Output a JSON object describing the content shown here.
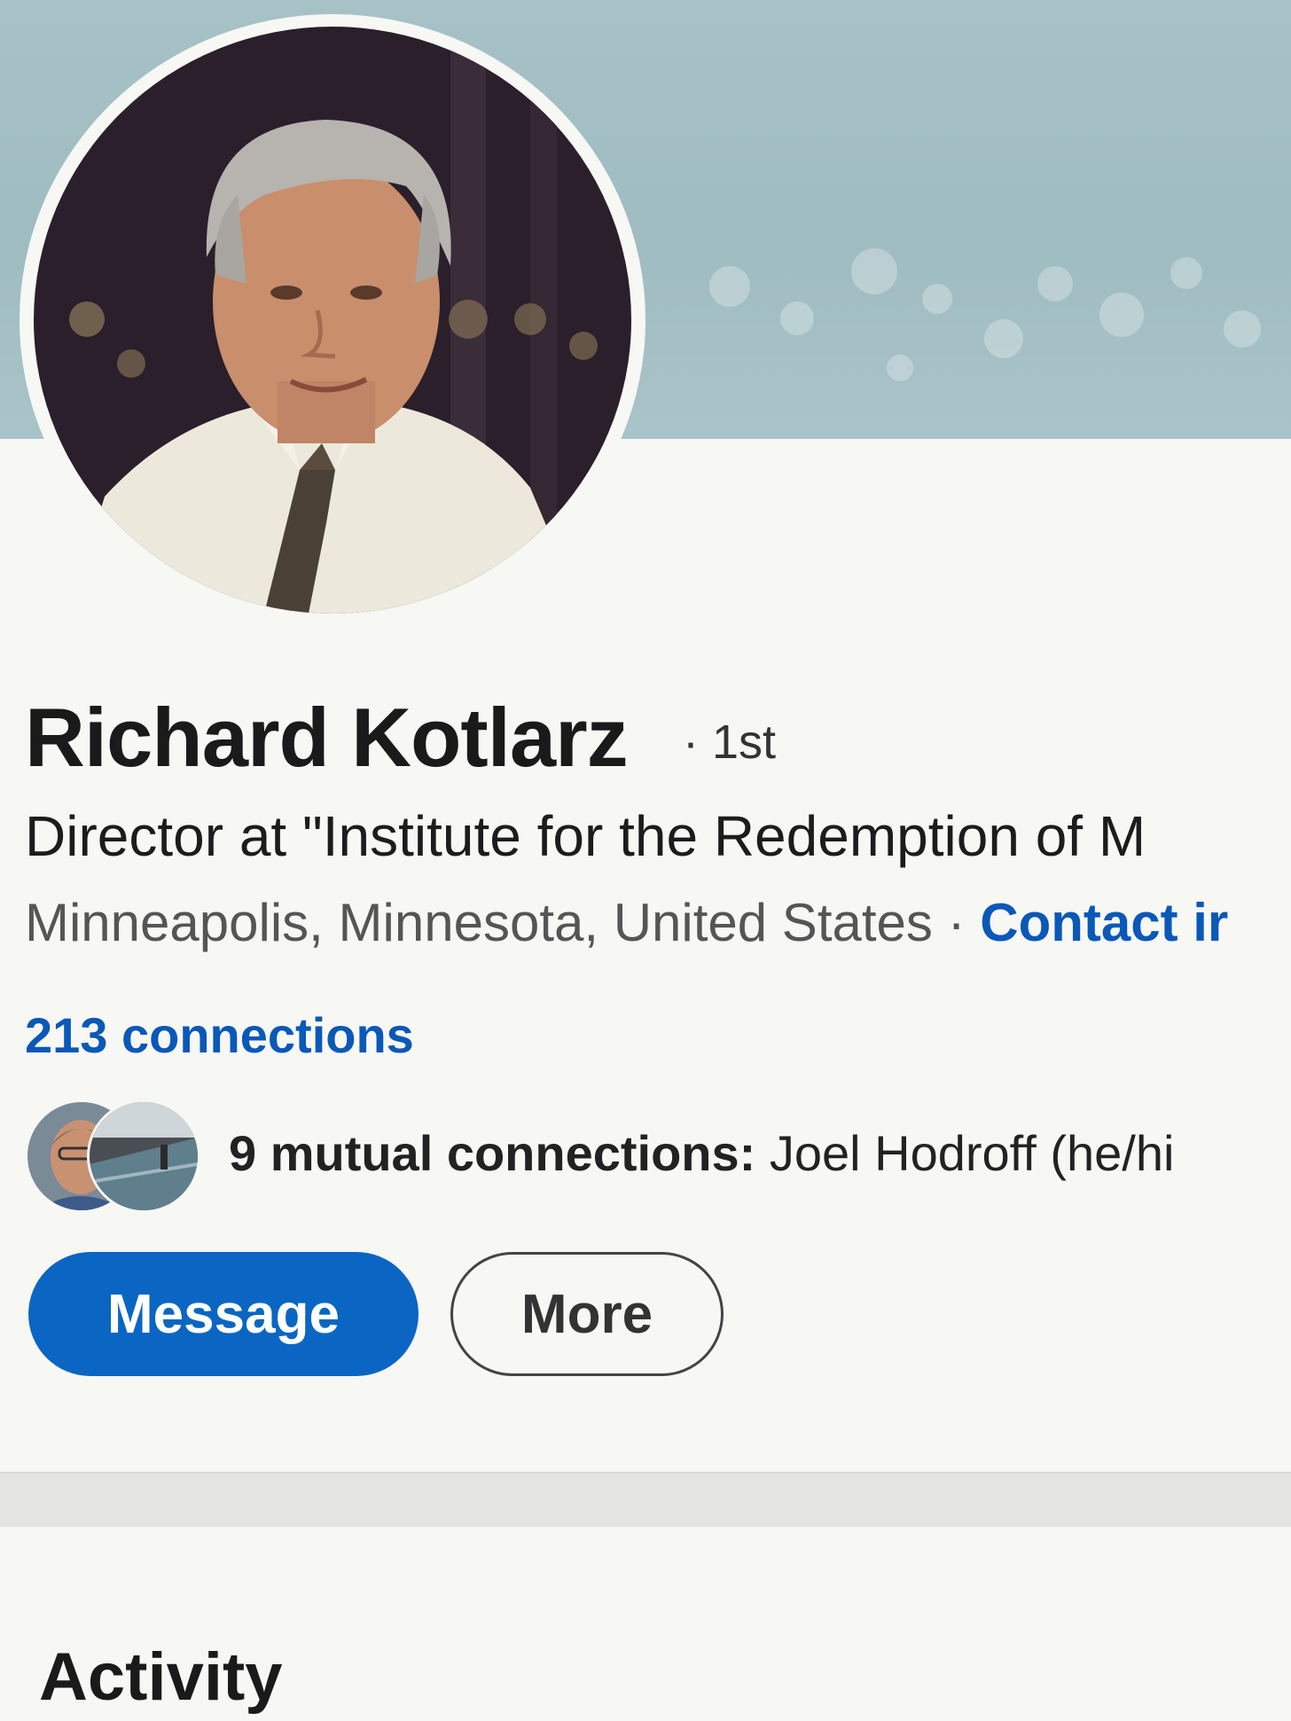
{
  "profile": {
    "name": "Richard Kotlarz",
    "degree": "· 1st",
    "headline": "Director at \"Institute for the Redemption of M",
    "location": "Minneapolis, Minnesota, United States",
    "separator": " · ",
    "contact_link": "Contact ir",
    "connections": "213 connections",
    "mutual": {
      "count": "9 mutual connections:",
      "names": " Joel Hodroff (he/hi"
    }
  },
  "actions": {
    "message_label": "Message",
    "more_label": "More"
  },
  "activity": {
    "title": "Activity"
  },
  "colors": {
    "accent": "#0a66c2",
    "link": "#0a58b8",
    "cover": "#a7c2c6"
  }
}
